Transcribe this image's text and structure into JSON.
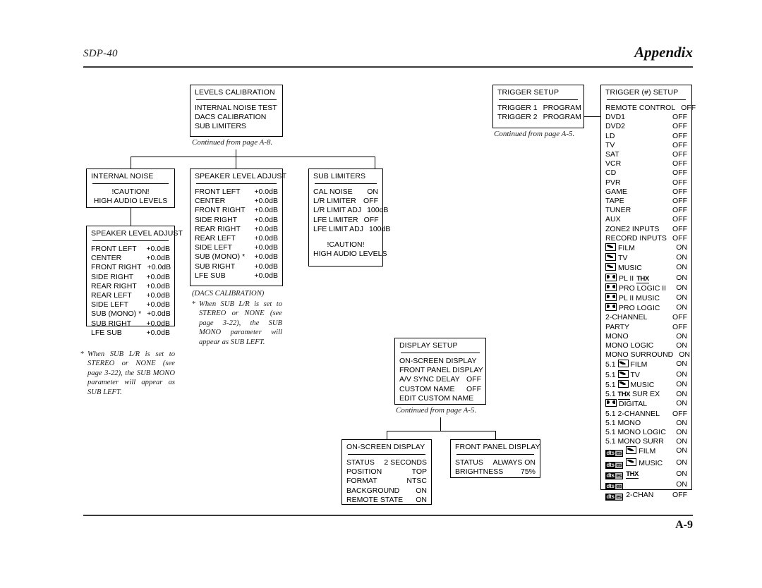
{
  "page": {
    "model": "SDP-40",
    "section": "Appendix",
    "page_number": "A-9"
  },
  "captions": {
    "levels_calibration": "Continued from page A-8.",
    "trigger_setup": "Continued from page A-5.",
    "display_setup": "Continued from page A-5."
  },
  "footnotes": {
    "sub_lr_note": "When SUB L/R is set to STEREO or NONE (see page 3-22), the SUB MONO parameter will appear as SUB LEFT.",
    "star": "*",
    "dacs_label": "(DACS CALIBRATION)"
  },
  "boxes": {
    "levels_calibration": {
      "title": "LEVELS CALIBRATION",
      "rows": [
        {
          "label": "INTERNAL NOISE TEST",
          "value": ""
        },
        {
          "label": "DACS CALIBRATION",
          "value": ""
        },
        {
          "label": "SUB LIMITERS",
          "value": ""
        }
      ]
    },
    "internal_noise": {
      "title": "INTERNAL NOISE",
      "caution_line1": "!CAUTION!",
      "caution_line2": "HIGH AUDIO LEVELS"
    },
    "speaker_level_adjust_left": {
      "title": "SPEAKER LEVEL ADJUST",
      "rows": [
        {
          "label": "FRONT LEFT",
          "value": "+0.0dB"
        },
        {
          "label": "CENTER",
          "value": "+0.0dB"
        },
        {
          "label": "FRONT RIGHT",
          "value": "+0.0dB"
        },
        {
          "label": "SIDE RIGHT",
          "value": "+0.0dB"
        },
        {
          "label": "REAR RIGHT",
          "value": "+0.0dB"
        },
        {
          "label": "REAR LEFT",
          "value": "+0.0dB"
        },
        {
          "label": "SIDE LEFT",
          "value": "+0.0dB"
        },
        {
          "label": "SUB (MONO) *",
          "value": "+0.0dB"
        },
        {
          "label": "SUB RIGHT",
          "value": "+0.0dB"
        },
        {
          "label": "LFE SUB",
          "value": "+0.0dB"
        }
      ]
    },
    "speaker_level_adjust_mid": {
      "title": "SPEAKER LEVEL ADJUST",
      "rows": [
        {
          "label": "FRONT LEFT",
          "value": "+0.0dB"
        },
        {
          "label": "CENTER",
          "value": "+0.0dB"
        },
        {
          "label": "FRONT RIGHT",
          "value": "+0.0dB"
        },
        {
          "label": "SIDE RIGHT",
          "value": "+0.0dB"
        },
        {
          "label": "REAR RIGHT",
          "value": "+0.0dB"
        },
        {
          "label": "REAR LEFT",
          "value": "+0.0dB"
        },
        {
          "label": "SIDE LEFT",
          "value": "+0.0dB"
        },
        {
          "label": "SUB (MONO) *",
          "value": "+0.0dB"
        },
        {
          "label": "SUB RIGHT",
          "value": "+0.0dB"
        },
        {
          "label": "LFE SUB",
          "value": "+0.0dB"
        }
      ]
    },
    "sub_limiters": {
      "title": "SUB LIMITERS",
      "rows": [
        {
          "label": "CAL NOISE",
          "value": "ON"
        },
        {
          "label": "L/R LIMITER",
          "value": "OFF"
        },
        {
          "label": "L/R LIMIT ADJ",
          "value": "100dB"
        },
        {
          "label": "LFE LIMITER",
          "value": "OFF"
        },
        {
          "label": "LFE LIMIT ADJ",
          "value": "100dB"
        }
      ],
      "caution_line1": "!CAUTION!",
      "caution_line2": "HIGH AUDIO LEVELS"
    },
    "trigger_setup": {
      "title": "TRIGGER SETUP",
      "rows": [
        {
          "label": "TRIGGER 1",
          "value": "PROGRAM"
        },
        {
          "label": "TRIGGER 2",
          "value": "PROGRAM"
        }
      ]
    },
    "trigger_number_setup": {
      "title": "TRIGGER (#) SETUP",
      "rows": [
        {
          "icon": "",
          "label": "REMOTE CONTROL",
          "value": "OFF"
        },
        {
          "icon": "",
          "label": "DVD1",
          "value": "OFF"
        },
        {
          "icon": "",
          "label": "DVD2",
          "value": "OFF"
        },
        {
          "icon": "",
          "label": "LD",
          "value": "OFF"
        },
        {
          "icon": "",
          "label": "TV",
          "value": "OFF"
        },
        {
          "icon": "",
          "label": "SAT",
          "value": "OFF"
        },
        {
          "icon": "",
          "label": "VCR",
          "value": "OFF"
        },
        {
          "icon": "",
          "label": "CD",
          "value": "OFF"
        },
        {
          "icon": "",
          "label": "PVR",
          "value": "OFF"
        },
        {
          "icon": "",
          "label": "GAME",
          "value": "OFF"
        },
        {
          "icon": "",
          "label": "TAPE",
          "value": "OFF"
        },
        {
          "icon": "",
          "label": "TUNER",
          "value": "OFF"
        },
        {
          "icon": "",
          "label": "AUX",
          "value": "OFF"
        },
        {
          "icon": "",
          "label": "ZONE2 INPUTS",
          "value": "OFF"
        },
        {
          "icon": "",
          "label": "RECORD INPUTS",
          "value": "OFF"
        },
        {
          "icon": "dts-neo",
          "label": "FILM",
          "value": "ON"
        },
        {
          "icon": "dts-neo",
          "label": "TV",
          "value": "ON"
        },
        {
          "icon": "dts-neo",
          "label": "MUSIC",
          "value": "ON"
        },
        {
          "icon": "dolby",
          "label": "PL II",
          "suffix": "thx",
          "value": "ON"
        },
        {
          "icon": "dolby",
          "label": "PRO LOGIC II",
          "value": "ON"
        },
        {
          "icon": "dolby",
          "label": "PL II MUSIC",
          "value": "ON"
        },
        {
          "icon": "dolby",
          "label": "PRO LOGIC",
          "value": "ON"
        },
        {
          "icon": "",
          "label": "2-CHANNEL",
          "value": "OFF"
        },
        {
          "icon": "",
          "label": "PARTY",
          "value": "OFF"
        },
        {
          "icon": "",
          "label": "MONO",
          "value": "ON"
        },
        {
          "icon": "",
          "label": "MONO LOGIC",
          "value": "ON"
        },
        {
          "icon": "",
          "label": "MONO SURROUND",
          "value": "ON"
        },
        {
          "prefix": "5.1",
          "icon": "dts-neo",
          "label": "FILM",
          "value": "ON"
        },
        {
          "prefix": "5.1",
          "icon": "dts-neo",
          "label": "TV",
          "value": "ON"
        },
        {
          "prefix": "5.1",
          "icon": "dts-neo",
          "label": "MUSIC",
          "value": "ON"
        },
        {
          "prefix": "5.1",
          "icon": "thx",
          "label": "SUR EX",
          "value": "ON"
        },
        {
          "icon": "dolby",
          "label": "DIGITAL",
          "value": "ON"
        },
        {
          "prefix": "5.1",
          "icon": "",
          "label": "2-CHANNEL",
          "value": "OFF"
        },
        {
          "prefix": "5.1",
          "icon": "",
          "label": "MONO",
          "value": "ON"
        },
        {
          "prefix": "5.1",
          "icon": "",
          "label": "MONO LOGIC",
          "value": "ON"
        },
        {
          "prefix": "5.1",
          "icon": "",
          "label": "MONO SURR",
          "value": "ON"
        },
        {
          "icon": "dts-es",
          "icon2": "dts-neo",
          "label": "FILM",
          "value": "ON"
        },
        {
          "icon": "dts-es",
          "icon2": "dts-neo",
          "label": "MUSIC",
          "value": "ON"
        },
        {
          "icon": "dts-es",
          "icon2": "thx",
          "label": "",
          "value": "ON"
        },
        {
          "icon": "dts-es",
          "label": "",
          "value": "ON"
        },
        {
          "icon": "dts-es",
          "label": "2-CHAN",
          "value": "OFF"
        }
      ]
    },
    "display_setup": {
      "title": "DISPLAY SETUP",
      "rows": [
        {
          "label": "ON-SCREEN DISPLAY",
          "value": ""
        },
        {
          "label": "FRONT PANEL DISPLAY",
          "value": ""
        },
        {
          "label": "A/V SYNC DELAY",
          "value": "OFF"
        },
        {
          "label": "CUSTOM NAME",
          "value": "OFF"
        },
        {
          "label": "EDIT CUSTOM NAME",
          "value": ""
        }
      ]
    },
    "on_screen_display": {
      "title": "ON-SCREEN DISPLAY",
      "rows": [
        {
          "label": "STATUS",
          "value": "2 SECONDS"
        },
        {
          "label": "POSITION",
          "value": "TOP"
        },
        {
          "label": "FORMAT",
          "value": "NTSC"
        },
        {
          "label": "BACKGROUND",
          "value": "ON"
        },
        {
          "label": "REMOTE STATE",
          "value": "ON"
        }
      ]
    },
    "front_panel_display": {
      "title": "FRONT PANEL DISPLAY",
      "rows": [
        {
          "label": "STATUS",
          "value": "ALWAYS ON"
        },
        {
          "label": "BRIGHTNESS",
          "value": "75%"
        }
      ]
    }
  },
  "glyph_labels": {
    "dts_neo": "dts-neo6-logo",
    "dolby": "dolby-double-d-logo",
    "thx": "THX",
    "dts": "dts",
    "es": "es"
  }
}
